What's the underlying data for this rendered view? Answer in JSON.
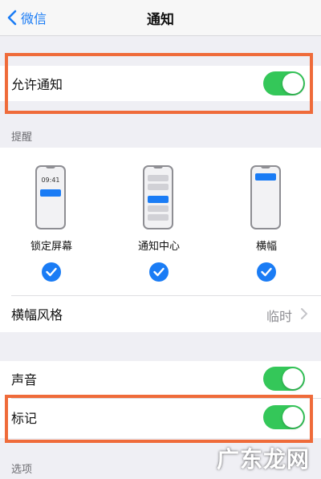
{
  "nav": {
    "back_label": "微信",
    "title": "通知"
  },
  "allow": {
    "label": "允许通知",
    "enabled": true
  },
  "alerts": {
    "section_title": "提醒",
    "lock_time": "09:41",
    "items": [
      {
        "label": "锁定屏幕",
        "checked": true
      },
      {
        "label": "通知中心",
        "checked": true
      },
      {
        "label": "横幅",
        "checked": true
      }
    ]
  },
  "banner_style": {
    "label": "横幅风格",
    "value": "临时"
  },
  "sound": {
    "label": "声音",
    "enabled": true
  },
  "badges": {
    "label": "标记",
    "enabled": true
  },
  "options": {
    "section_title": "选项"
  },
  "watermark": "广东龙网",
  "colors": {
    "accent": "#1a7cf5",
    "toggle_on": "#34c759",
    "highlight": "#ef6b3a"
  }
}
